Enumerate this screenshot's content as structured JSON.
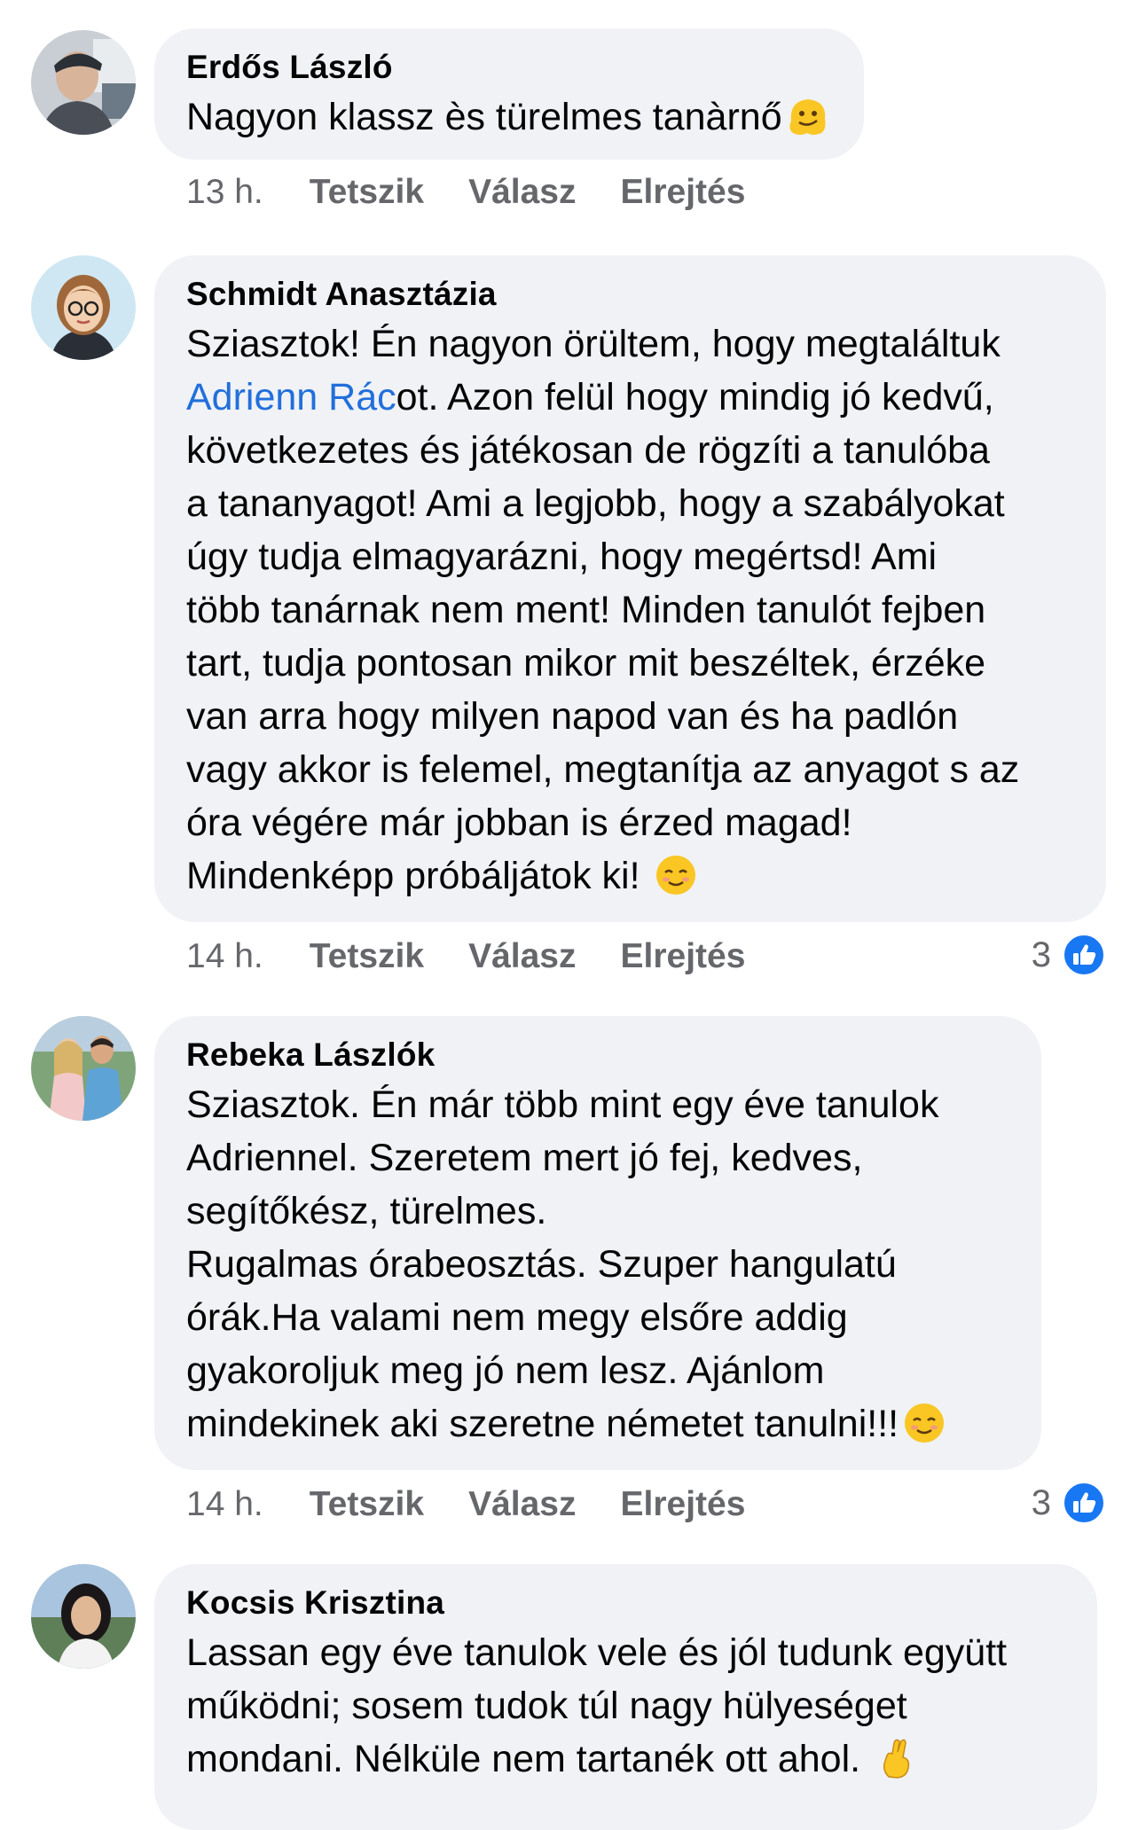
{
  "comments": [
    {
      "author": "Erdős László",
      "text_before": "Nagyon klassz ès türelmes tanàrnő",
      "text_mention": "",
      "text_after": "",
      "emoji": "melting-face-emoji",
      "time": "13 h.",
      "like": "Tetszik",
      "reply": "Válasz",
      "hide": "Elrejtés",
      "reaction_count": ""
    },
    {
      "author": "Schmidt Anasztázia",
      "text_before": "Sziasztok! Én nagyon örültem, hogy megtaláltuk\n",
      "text_mention": "Adrienn Rác",
      "text_after": "ot. Azon felül hogy mindig jó kedvű,\nkövetkezetes és játékosan de rögzíti a tanulóba\na tananyagot! Ami a legjobb, hogy a szabályokat\núgy tudja elmagyarázni, hogy megértsd! Ami\ntöbb tanárnak nem ment! Minden tanulót fejben\ntart, tudja pontosan mikor mit beszéltek, érzéke\nvan arra hogy milyen napod van és ha padlón\nvagy akkor is felemel, megtanítja az anyagot s az\nóra végére már jobban is érzed magad!\nMindenképp próbáljátok ki! ",
      "emoji": "smiling-face-emoji",
      "time": "14 h.",
      "like": "Tetszik",
      "reply": "Válasz",
      "hide": "Elrejtés",
      "reaction_count": "3"
    },
    {
      "author": "Rebeka Lászlók",
      "text_before": "Sziasztok. Én már több mint egy éve tanulok\nAdriennel. Szeretem mert jó fej, kedves,\nsegítőkész, türelmes.\nRugalmas órabeosztás. Szuper hangulatú\nórák.Ha valami nem megy elsőre addig\ngyakoroljuk meg jó nem lesz. Ajánlom\nmindekinek aki szeretne németet tanulni!!!",
      "text_mention": "",
      "text_after": "",
      "emoji": "smiling-face-emoji",
      "time": "14 h.",
      "like": "Tetszik",
      "reply": "Válasz",
      "hide": "Elrejtés",
      "reaction_count": "3"
    },
    {
      "author": "Kocsis Krisztina",
      "text_before": "Lassan egy éve tanulok vele és jól tudunk együtt\nműködni; sosem tudok túl nagy hülyeséget\nmondani. Nélküle nem tartanék ott ahol. ",
      "text_mention": "",
      "text_after": "",
      "emoji": "crossed-fingers-emoji",
      "time": "",
      "like": "",
      "reply": "",
      "hide": "",
      "reaction_count": ""
    }
  ],
  "colors": {
    "bubble": "#f0f2f5",
    "meta": "#65676b",
    "mention": "#216fdb",
    "like_blue": "#1877f2"
  }
}
